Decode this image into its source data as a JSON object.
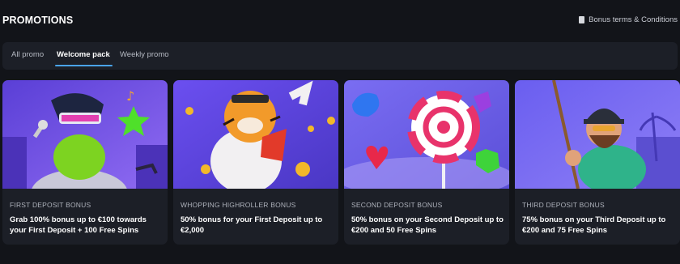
{
  "header": {
    "title": "PROMOTIONS",
    "terms_label": "Bonus terms & Conditions",
    "terms_icon": "document-icon"
  },
  "tabs": [
    {
      "label": "All promo",
      "active": false
    },
    {
      "label": "Welcome pack",
      "active": true
    },
    {
      "label": "Weekly promo",
      "active": false
    }
  ],
  "accent_color": "#4aa3e8",
  "cards": [
    {
      "subtitle": "FIRST DEPOSIT BONUS",
      "text": "Grab 100% bonus up to €100 towards your First Deposit + 100 Free Spins",
      "art": "frog-singer-image"
    },
    {
      "subtitle": "WHOPPING HIGHROLLER BONUS",
      "text": "50% bonus for your First Deposit up to €2,000",
      "art": "tiger-image"
    },
    {
      "subtitle": "SECOND DEPOSIT BONUS",
      "text": "50% bonus on your Second Deposit up to €200 and 50 Free Spins",
      "art": "candy-lollipop-image"
    },
    {
      "subtitle": "THIRD DEPOSIT BONUS",
      "text": "75% bonus on your Third Deposit up to €200 and 75 Free Spins",
      "art": "fisherman-image"
    }
  ]
}
